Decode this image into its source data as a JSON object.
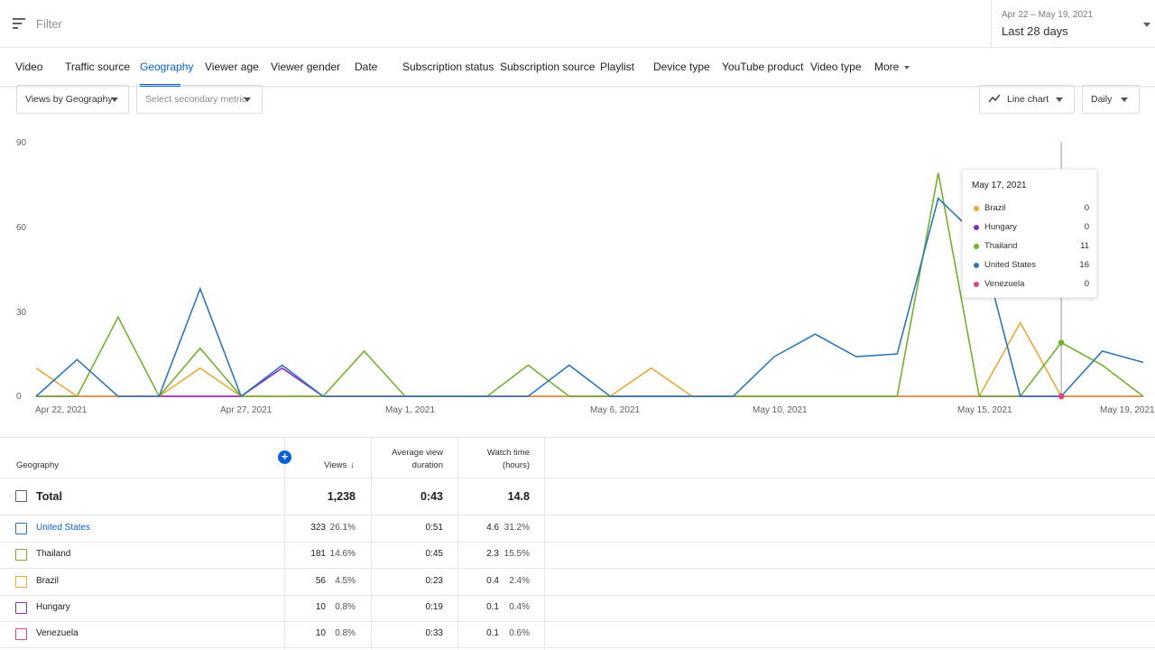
{
  "filter": {
    "label": "Filter"
  },
  "date": {
    "range": "Apr 22 – May 19, 2021",
    "preset": "Last 28 days"
  },
  "tabs": [
    {
      "label": "Video"
    },
    {
      "label": "Traffic source"
    },
    {
      "label": "Geography"
    },
    {
      "label": "Viewer age"
    },
    {
      "label": "Viewer gender"
    },
    {
      "label": "Date"
    },
    {
      "label": "Subscription status"
    },
    {
      "label": "Subscription source"
    },
    {
      "label": "Playlist"
    },
    {
      "label": "Device type"
    },
    {
      "label": "YouTube product"
    },
    {
      "label": "Video type"
    },
    {
      "label": "More"
    }
  ],
  "controls": {
    "metric": "Views by Geography",
    "secondary": "Select secondary metric",
    "chart_type": "Line chart",
    "interval": "Daily"
  },
  "colors": {
    "Brazil": "#e8a838",
    "Hungary": "#8e2bbd",
    "Thailand": "#73b12c",
    "United States": "#2d77b8",
    "Venezuela": "#e0457b",
    "accent": "#065fd4"
  },
  "chart_data": {
    "type": "line",
    "x": [
      "Apr 22",
      "Apr 23",
      "Apr 24",
      "Apr 25",
      "Apr 26",
      "Apr 27",
      "Apr 28",
      "Apr 29",
      "Apr 30",
      "May 1",
      "May 2",
      "May 3",
      "May 4",
      "May 5",
      "May 6",
      "May 7",
      "May 8",
      "May 9",
      "May 10",
      "May 11",
      "May 12",
      "May 13",
      "May 14",
      "May 15",
      "May 16",
      "May 17",
      "May 18",
      "May 19"
    ],
    "x_tick_labels": [
      "Apr 22, 2021",
      "Apr 27, 2021",
      "May 1, 2021",
      "May 6, 2021",
      "May 10, 2021",
      "May 15, 2021",
      "May 19, 2021"
    ],
    "ylim": [
      0,
      90
    ],
    "y_ticks": [
      "0",
      "30",
      "60",
      "90"
    ],
    "series": [
      {
        "name": "Thailand",
        "values": [
          0,
          0,
          28,
          0,
          17,
          0,
          0,
          0,
          16,
          0,
          0,
          0,
          11,
          0,
          0,
          0,
          0,
          0,
          0,
          0,
          0,
          0,
          79,
          0,
          0,
          19,
          11,
          0
        ]
      },
      {
        "name": "United States",
        "values": [
          0,
          13,
          0,
          0,
          38,
          0,
          11,
          0,
          0,
          0,
          0,
          0,
          0,
          11,
          0,
          0,
          0,
          0,
          14,
          22,
          14,
          15,
          70,
          56,
          0,
          0,
          16,
          12
        ]
      },
      {
        "name": "Brazil",
        "values": [
          10,
          0,
          0,
          0,
          10,
          0,
          0,
          0,
          0,
          0,
          0,
          0,
          0,
          0,
          0,
          10,
          0,
          0,
          0,
          0,
          0,
          0,
          0,
          0,
          26,
          0,
          0,
          0
        ]
      },
      {
        "name": "Hungary",
        "values": [
          0,
          0,
          0,
          0,
          0,
          0,
          10,
          0,
          0,
          0,
          0,
          0,
          0,
          0,
          0,
          0,
          0,
          0,
          0,
          0,
          0,
          0,
          0,
          0,
          0,
          0,
          0,
          0
        ]
      },
      {
        "name": "Venezuela",
        "values": [
          0,
          0,
          0,
          0,
          0,
          0,
          0,
          0,
          0,
          0,
          0,
          0,
          0,
          0,
          0,
          0,
          0,
          0,
          0,
          0,
          0,
          0,
          0,
          0,
          0,
          0,
          0,
          0
        ]
      }
    ],
    "highlight_index": 25
  },
  "tooltip": {
    "title": "May 17, 2021",
    "rows": [
      {
        "name": "Brazil",
        "value": "0"
      },
      {
        "name": "Hungary",
        "value": "0"
      },
      {
        "name": "Thailand",
        "value": "11"
      },
      {
        "name": "United States",
        "value": "16"
      },
      {
        "name": "Venezuela",
        "value": "0"
      }
    ]
  },
  "table": {
    "headers": {
      "geography": "Geography",
      "views": "Views",
      "avg_line1": "Average view",
      "avg_line2": "duration",
      "wt_line1": "Watch time",
      "wt_line2": "(hours)"
    },
    "total": {
      "label": "Total",
      "views": "1,238",
      "avg": "0:43",
      "watch": "14.8"
    },
    "rows": [
      {
        "name": "United States",
        "views": "323",
        "views_pct": "26.1%",
        "avg": "0:51",
        "watch": "4.6",
        "watch_pct": "31.2%"
      },
      {
        "name": "Thailand",
        "views": "181",
        "views_pct": "14.6%",
        "avg": "0:45",
        "watch": "2.3",
        "watch_pct": "15.5%"
      },
      {
        "name": "Brazil",
        "views": "56",
        "views_pct": "4.5%",
        "avg": "0:23",
        "watch": "0.4",
        "watch_pct": "2.4%"
      },
      {
        "name": "Hungary",
        "views": "10",
        "views_pct": "0.8%",
        "avg": "0:19",
        "watch": "0.1",
        "watch_pct": "0.4%"
      },
      {
        "name": "Venezuela",
        "views": "10",
        "views_pct": "0.8%",
        "avg": "0:33",
        "watch": "0.1",
        "watch_pct": "0.6%"
      }
    ]
  }
}
